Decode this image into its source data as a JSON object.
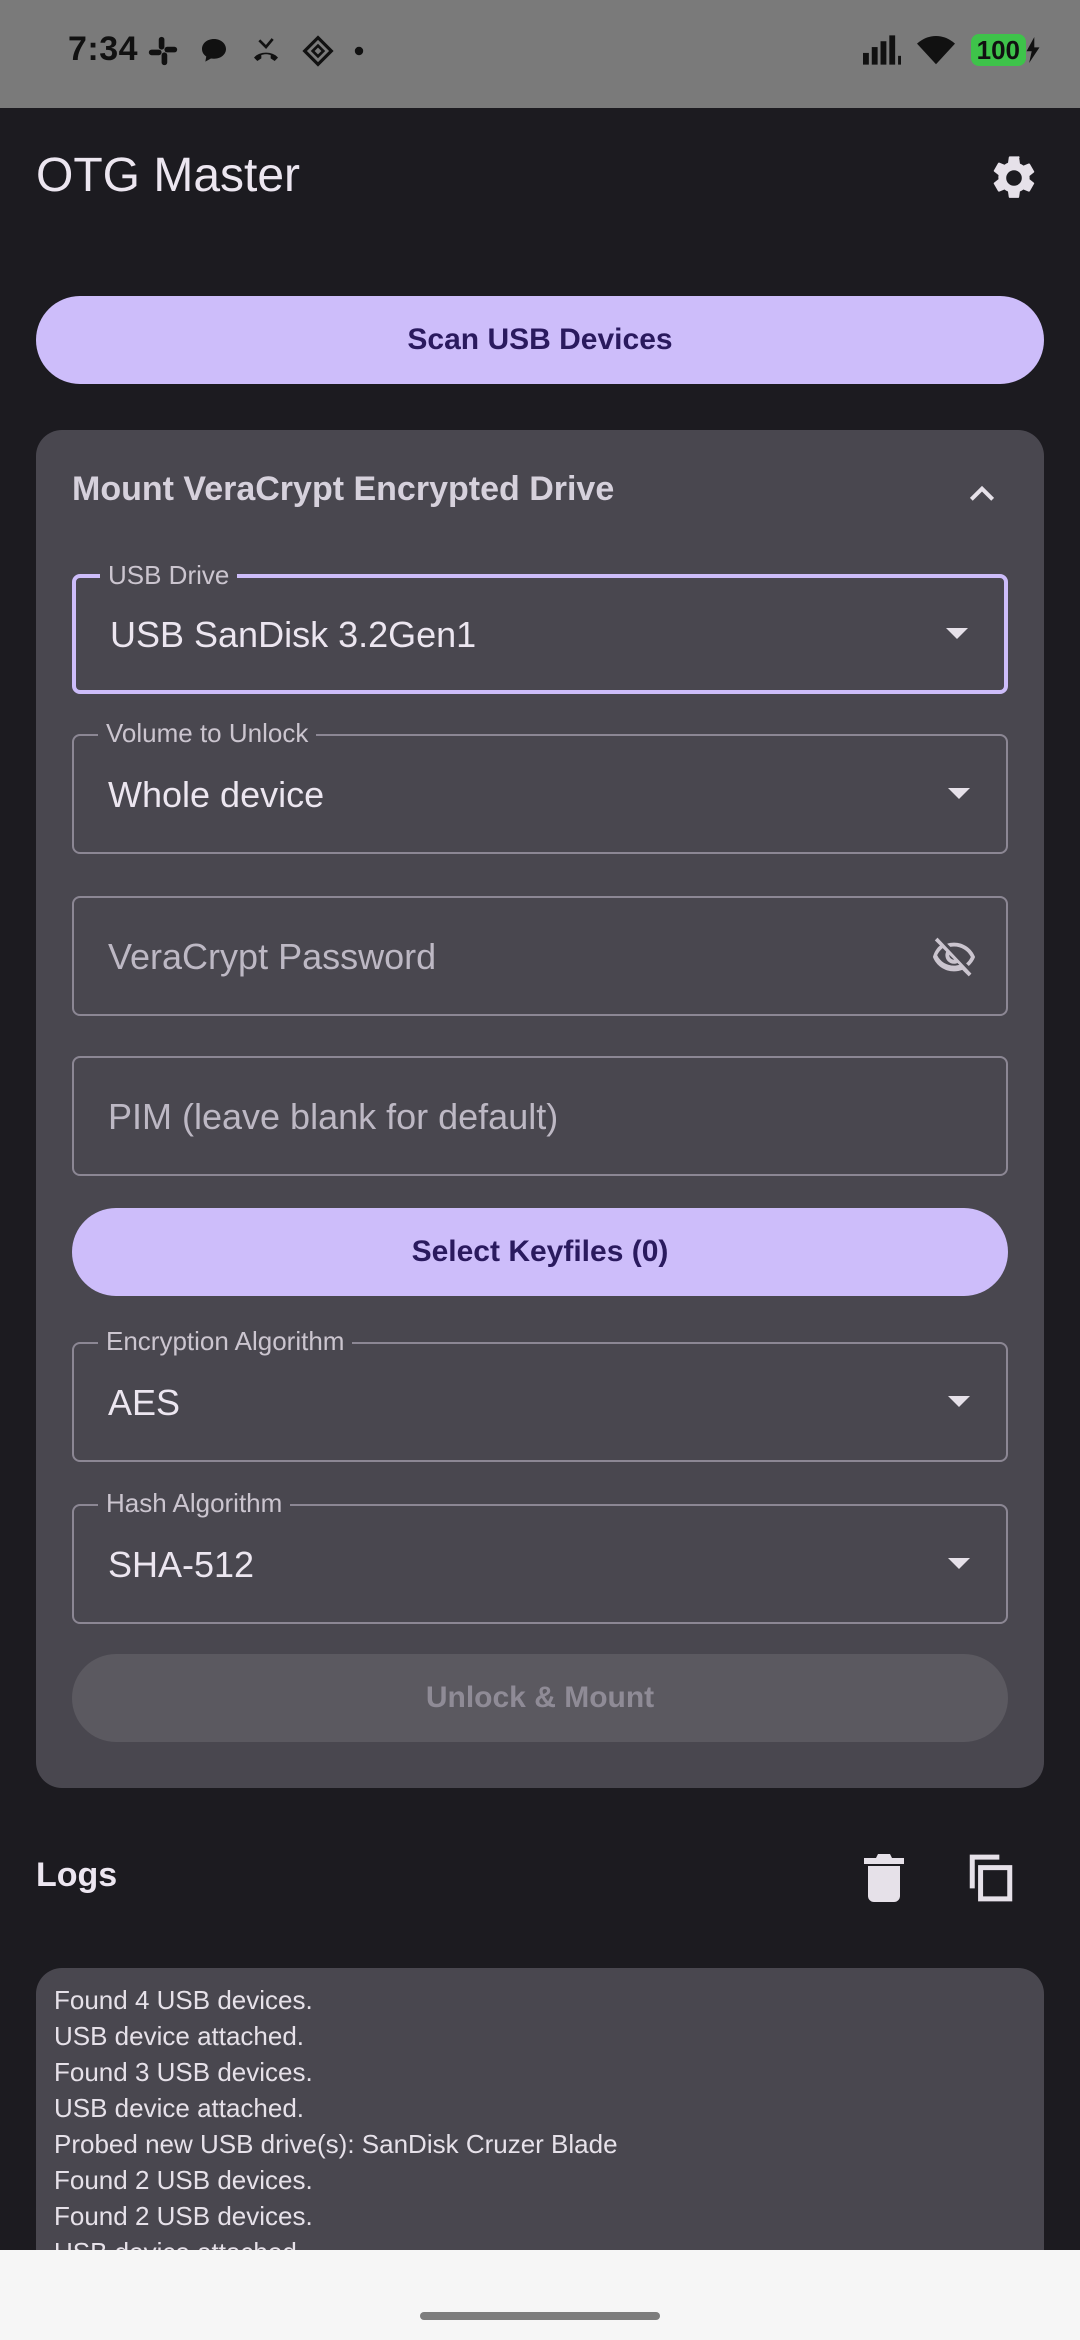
{
  "status_bar": {
    "time": "7:34",
    "battery": "100",
    "icons": [
      "slack-icon",
      "chat-icon",
      "missed-call-icon",
      "diamond-app-icon",
      "dot-icon",
      "signal-icon",
      "wifi-icon",
      "battery-charging-icon"
    ]
  },
  "header": {
    "title": "OTG Master",
    "settings_icon": "gear-icon"
  },
  "scan_button": {
    "label": "Scan USB Devices"
  },
  "mount_card": {
    "title": "Mount VeraCrypt Encrypted Drive",
    "collapse_icon": "chevron-up-icon",
    "usb_drive": {
      "label": "USB Drive",
      "value": "USB SanDisk 3.2Gen1"
    },
    "volume": {
      "label": "Volume to Unlock",
      "value": "Whole device"
    },
    "password": {
      "placeholder": "VeraCrypt Password",
      "toggle_icon": "eye-off-icon"
    },
    "pim": {
      "placeholder": "PIM (leave blank for default)"
    },
    "keyfiles_button": {
      "label": "Select Keyfiles (0)"
    },
    "encryption": {
      "label": "Encryption Algorithm",
      "value": "AES"
    },
    "hash": {
      "label": "Hash Algorithm",
      "value": "SHA-512"
    },
    "unlock_button": {
      "label": "Unlock & Mount",
      "enabled": false
    }
  },
  "logs": {
    "title": "Logs",
    "lines": [
      "Found 4 USB devices.",
      "USB device attached.",
      "Found 3 USB devices.",
      "USB device attached.",
      "Probed new USB drive(s): SanDisk Cruzer Blade",
      "Found 2 USB devices.",
      "Found 2 USB devices.",
      "USB device attached."
    ]
  },
  "colors": {
    "background": "#1c1b20",
    "card": "#49474f",
    "accent": "#cdbdfa",
    "accent_text": "#2a1a5e"
  }
}
